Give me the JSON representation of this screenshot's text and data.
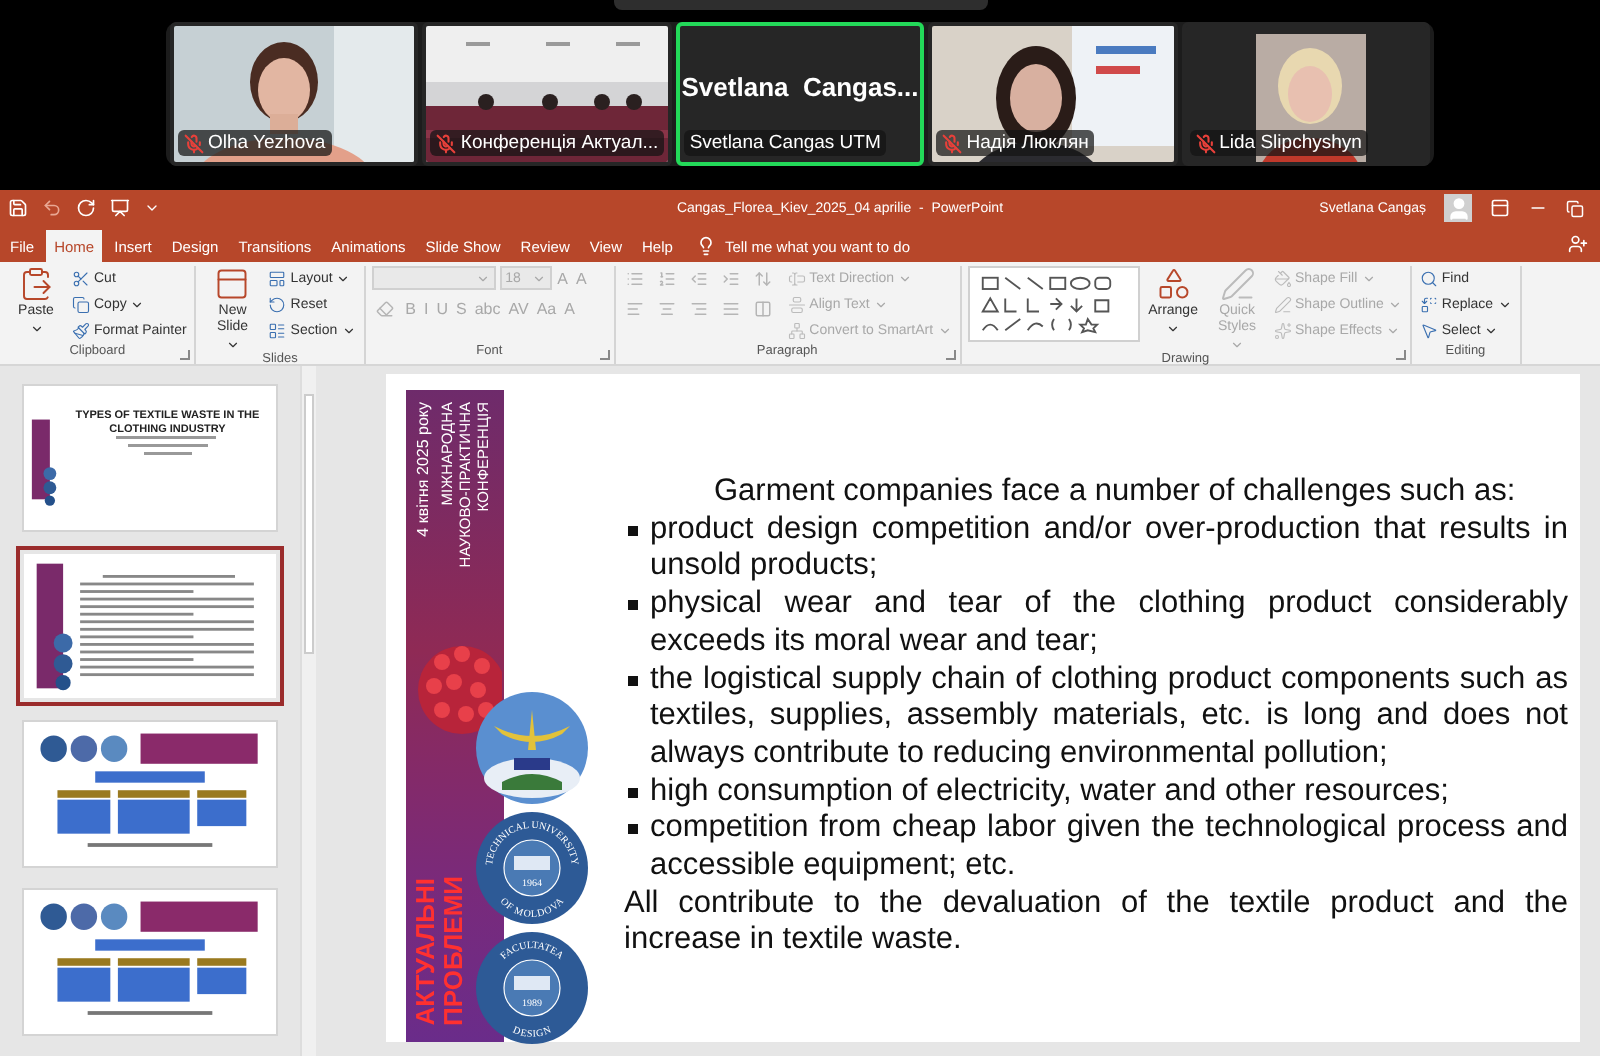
{
  "meeting": {
    "participants": [
      {
        "name": "Olha Yezhova",
        "muted": true,
        "video": true,
        "active_speaker": false
      },
      {
        "name": "Конференція Актуал...",
        "muted": true,
        "video": true,
        "active_speaker": false
      },
      {
        "name": "Svetlana Cangas UTM",
        "display_name": "Svetlana  Cangas...",
        "muted": false,
        "video": false,
        "active_speaker": true
      },
      {
        "name": "Надія Люклян",
        "muted": true,
        "video": true,
        "active_speaker": false
      },
      {
        "name": "Lida Slipchyshyn",
        "muted": true,
        "video": true,
        "active_speaker": false
      }
    ]
  },
  "powerpoint": {
    "title": "Cangas_Florea_Kiev_2025_04 aprilie  -  PowerPoint",
    "user": "Svetlana Cangaș",
    "tabs": [
      {
        "label": "File",
        "selected": false
      },
      {
        "label": "Home",
        "selected": true
      },
      {
        "label": "Insert",
        "selected": false
      },
      {
        "label": "Design",
        "selected": false
      },
      {
        "label": "Transitions",
        "selected": false
      },
      {
        "label": "Animations",
        "selected": false
      },
      {
        "label": "Slide Show",
        "selected": false
      },
      {
        "label": "Review",
        "selected": false
      },
      {
        "label": "View",
        "selected": false
      },
      {
        "label": "Help",
        "selected": false
      }
    ],
    "tell_me": "Tell me what you want to do",
    "ribbon": [
      {
        "label": "Clipboard",
        "launcher": true,
        "items": [
          {
            "kind": "large",
            "label": "Paste",
            "disabled": false,
            "dropdown": true
          },
          {
            "kind": "small",
            "label": "Cut",
            "disabled": false,
            "dropdown": false
          },
          {
            "kind": "small",
            "label": "Copy",
            "disabled": false,
            "dropdown": true
          },
          {
            "kind": "small",
            "label": "Format Painter",
            "disabled": false,
            "dropdown": false
          }
        ]
      },
      {
        "label": "Slides",
        "launcher": false,
        "items": [
          {
            "kind": "large",
            "label": "New Slide",
            "disabled": false,
            "dropdown": true
          },
          {
            "kind": "small",
            "label": "Layout",
            "disabled": false,
            "dropdown": true
          },
          {
            "kind": "small",
            "label": "Reset",
            "disabled": false,
            "dropdown": false
          },
          {
            "kind": "small",
            "label": "Section",
            "disabled": false,
            "dropdown": true
          }
        ]
      },
      {
        "label": "Font",
        "launcher": true,
        "items": [
          {
            "kind": "combo",
            "wide": true,
            "disabled": true
          },
          {
            "kind": "combo",
            "value": "18",
            "wide": false,
            "disabled": true
          },
          {
            "kind": "glyph",
            "label": "A",
            "disabled": true
          },
          {
            "kind": "glyph",
            "label": "A",
            "disabled": true
          },
          {
            "kind": "tool",
            "disabled": true
          },
          {
            "kind": "glyph",
            "label": "B",
            "disabled": true
          },
          {
            "kind": "glyph",
            "label": "I",
            "disabled": true
          },
          {
            "kind": "glyph",
            "label": "U",
            "disabled": true
          },
          {
            "kind": "glyph",
            "label": "S",
            "disabled": true
          },
          {
            "kind": "glyph",
            "label": "abc",
            "disabled": true
          },
          {
            "kind": "glyph",
            "label": "AV",
            "disabled": true
          },
          {
            "kind": "glyph",
            "label": "Aa",
            "disabled": true
          },
          {
            "kind": "glyph",
            "label": "A",
            "disabled": true
          }
        ]
      },
      {
        "label": "Paragraph",
        "launcher": true,
        "items": [
          {
            "kind": "tool",
            "disabled": true
          },
          {
            "kind": "tool",
            "disabled": true
          },
          {
            "kind": "tool",
            "disabled": true
          },
          {
            "kind": "tool",
            "disabled": true
          },
          {
            "kind": "tool",
            "disabled": true
          },
          {
            "kind": "tool",
            "disabled": true
          },
          {
            "kind": "tool",
            "disabled": true
          },
          {
            "kind": "tool",
            "disabled": true
          },
          {
            "kind": "tool",
            "disabled": true
          },
          {
            "kind": "tool",
            "disabled": true
          },
          {
            "kind": "small",
            "label": "Text Direction",
            "disabled": true,
            "dropdown": true
          },
          {
            "kind": "small",
            "label": "Align Text",
            "disabled": true,
            "dropdown": true
          },
          {
            "kind": "small",
            "label": "Convert to SmartArt",
            "disabled": true,
            "dropdown": true
          }
        ]
      },
      {
        "label": "Drawing",
        "launcher": true,
        "items": [
          {
            "kind": "gallery",
            "disabled": false
          },
          {
            "kind": "large",
            "label": "Arrange",
            "disabled": false,
            "dropdown": true
          },
          {
            "kind": "large",
            "label": "Quick Styles",
            "disabled": true,
            "dropdown": true
          },
          {
            "kind": "small",
            "label": "Shape Fill",
            "disabled": true,
            "dropdown": true
          },
          {
            "kind": "small",
            "label": "Shape Outline",
            "disabled": true,
            "dropdown": true
          },
          {
            "kind": "small",
            "label": "Shape Effects",
            "disabled": true,
            "dropdown": true
          }
        ]
      },
      {
        "label": "Editing",
        "launcher": false,
        "items": [
          {
            "kind": "small",
            "label": "Find",
            "disabled": false,
            "dropdown": false
          },
          {
            "kind": "small",
            "label": "Replace",
            "disabled": false,
            "dropdown": true
          },
          {
            "kind": "small",
            "label": "Select",
            "disabled": false,
            "dropdown": true
          }
        ]
      }
    ],
    "thumbnails": [
      {
        "kind": "title",
        "title": "TYPES OF TEXTILE WASTE IN THE CLOTHING INDUSTRY",
        "selected": false
      },
      {
        "kind": "bullets",
        "selected": true
      },
      {
        "kind": "diagram",
        "selected": false
      },
      {
        "kind": "diagram",
        "selected": false
      }
    ],
    "slide": {
      "banner": {
        "date": "4 квітня 2025 року",
        "subtitle": [
          "МІЖНАРОДНА",
          "НАУКОВО-ПРАКТИЧНА",
          "КОНФЕРЕНЦІЯ"
        ],
        "title": [
          "АКТУАЛЬНІ",
          "ПРОБЛЕМИ"
        ]
      },
      "logos": [
        {
          "kind": "emblem"
        },
        {
          "kind": "seal",
          "top": "TECHNICAL UNIVERSITY",
          "bottom": "OF MOLDOVA",
          "year": "1964"
        },
        {
          "kind": "seal",
          "top": "FACULTATEA",
          "bottom": "DESIGN",
          "year": "1989"
        }
      ],
      "intro": "Garment companies face a number of challenges such as:",
      "bullets": [
        "product design competition and/or over-production that results in unsold products;",
        "physical wear and tear of the clothing product considerably exceeds its moral wear and tear;",
        "the logistical supply chain of clothing product components such as textiles, supplies, assembly materials, etc. is long and does not always contribute to reducing environmental pollution;",
        "high consumption of electricity, water and other resources;",
        "competition from cheap labor given the technological process and accessible equipment; etc."
      ],
      "conclusion": "All contribute to the devaluation of the textile product and the increase in textile waste."
    }
  }
}
